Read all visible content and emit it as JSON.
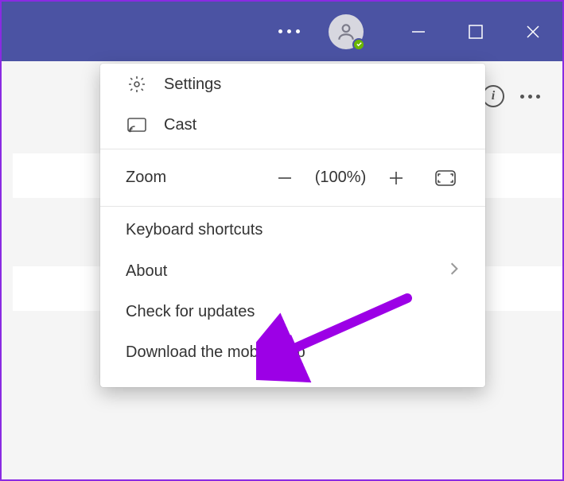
{
  "menu": {
    "settings": "Settings",
    "cast": "Cast",
    "zoom_label": "Zoom",
    "zoom_value": "(100%)",
    "keyboard_shortcuts": "Keyboard shortcuts",
    "about": "About",
    "check_updates": "Check for updates",
    "download_app": "Download the mobile app"
  },
  "annotation": {
    "target": "check_updates",
    "color": "#9c00e6"
  },
  "colors": {
    "titlebar": "#4b53a3",
    "presence": "#6bb700"
  }
}
